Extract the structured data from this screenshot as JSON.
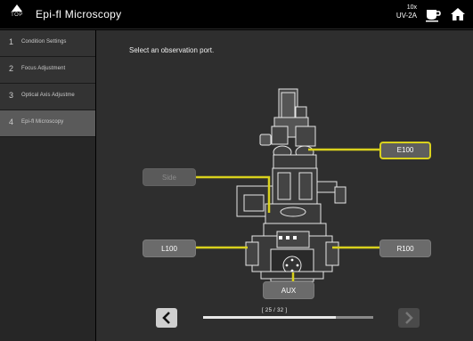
{
  "header": {
    "top_label": "TOP",
    "title": "Epi-fl Microscopy",
    "magnification": "10x",
    "objective": "UV-2A",
    "icons": [
      "home-up-arrow-icon",
      "cup-icon",
      "home-icon"
    ]
  },
  "sidebar": {
    "items": [
      {
        "num": "1",
        "label": "Condition Settings",
        "active": false
      },
      {
        "num": "2",
        "label": "Focus Adjustment",
        "active": false
      },
      {
        "num": "3",
        "label": "Optical Axis Adjustme",
        "active": false
      },
      {
        "num": "4",
        "label": "Epi-fl Microscopy",
        "active": true
      }
    ]
  },
  "main": {
    "prompt": "Select an observation port.",
    "ports": {
      "e100": "E100",
      "side": "Side",
      "l100": "L100",
      "r100": "R100",
      "aux": "AUX"
    },
    "selected_port": "E100",
    "page_indicator": "[ 25 / 32 ]",
    "progress": 0.78
  },
  "colors": {
    "accent": "#d9d11d",
    "background": "#2e2e2e",
    "sidebar_active": "#5a5a5a"
  }
}
